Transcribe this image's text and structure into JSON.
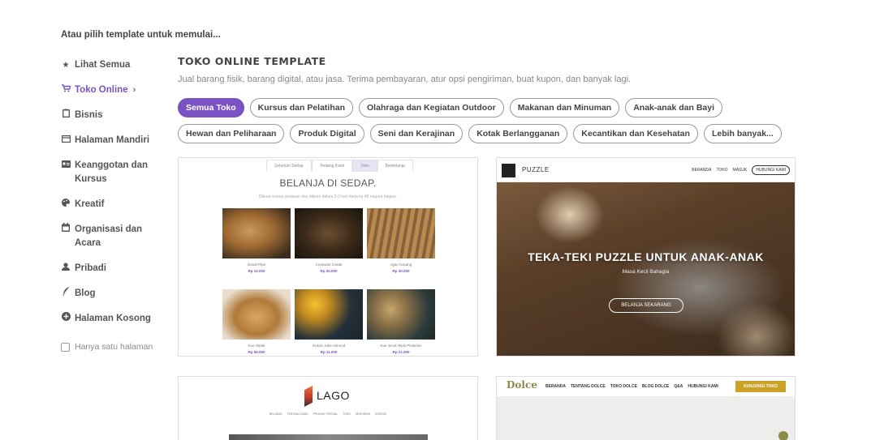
{
  "heading": "Atau pilih template untuk memulai...",
  "sidebar": {
    "items": [
      {
        "label": "Lihat Semua",
        "icon": "star-icon",
        "glyph": "★"
      },
      {
        "label": "Toko Online",
        "icon": "cart-icon",
        "glyph": "🛒",
        "active": true
      },
      {
        "label": "Bisnis",
        "icon": "clipboard-icon",
        "glyph": "📋"
      },
      {
        "label": "Halaman Mandiri",
        "icon": "window-icon",
        "glyph": "▭"
      },
      {
        "label": "Keanggotan dan Kursus",
        "icon": "id-card-icon",
        "glyph": "▤"
      },
      {
        "label": "Kreatif",
        "icon": "palette-icon",
        "glyph": "◕"
      },
      {
        "label": "Organisasi dan Acara",
        "icon": "calendar-icon",
        "glyph": "▦"
      },
      {
        "label": "Pribadi",
        "icon": "user-icon",
        "glyph": "👤"
      },
      {
        "label": "Blog",
        "icon": "feather-icon",
        "glyph": "✒"
      },
      {
        "label": "Halaman Kosong",
        "icon": "plus-circle-icon",
        "glyph": "⊕"
      }
    ],
    "single_page_label": "Hanya satu halaman"
  },
  "main": {
    "title": "TOKO ONLINE TEMPLATE",
    "description": "Jual barang fisik, barang digital, atau jasa. Terima pembayaran, atur opsi pengiriman, buat kupon, dan banyak lagi.",
    "chips_row1": [
      "Semua Toko",
      "Kursus dan Pelatihan",
      "Olahraga dan Kegiatan Outdoor",
      "Makanan dan Minuman",
      "Anak-anak dan Bayi"
    ],
    "chips_row2": [
      "Hewan dan Peliharaan",
      "Produk Digital",
      "Seni dan Kerajinan",
      "Kotak Berlangganan",
      "Kecantikan dan Kesehatan",
      "Lebih banyak..."
    ]
  },
  "templates": {
    "bakery": {
      "nav": [
        "Sebelum Sedap",
        "Tentang Kami",
        "Toko",
        "Berbelanja"
      ],
      "title": "BELANJA DI SEDAP.",
      "subtitle": "Dibuat sesuai pesanan dan dikirim dalam 2-3 hari kerja ke 48 negara bagian.",
      "products": [
        {
          "name": "Donat Pipe",
          "price": "Rp 12.000"
        },
        {
          "name": "Croissant Coklat",
          "price": "Rp 20.000"
        },
        {
          "name": "Ujian Kacang",
          "price": "Rp 30.000"
        },
        {
          "name": "Kue Steak",
          "price": "Rp 56.000"
        },
        {
          "name": "Dukuh Jahe Almond",
          "price": "Rp 11.000"
        },
        {
          "name": "Kue Jeruk Nipis Pistachio",
          "price": "Rp 21.000"
        }
      ]
    },
    "puzzle": {
      "brand": "PUZZLE",
      "menu": [
        "BERANDA",
        "TOKO",
        "MASUK"
      ],
      "contact_button": "HUBUNGI KAMI",
      "hero_title": "TEKA-TEKI PUZZLE UNTUK ANAK-ANAK",
      "hero_subtitle": "Masa Kecil Bahagia",
      "hero_button": "BELANJA SEKARANG"
    },
    "lago": {
      "brand": "LAGO",
      "nav": [
        "BELANJA",
        "TENTANG KAMI",
        "PRODUK SPESIAL",
        "TOKO",
        "DEKORASI",
        "KONTAK"
      ]
    },
    "dolce": {
      "brand": "Dolce",
      "menu": [
        "BERANDA",
        "TENTANG DOLCE",
        "TOKO DOLCE",
        "BLOG DOLCE",
        "Q&A",
        "HUBUNGI KAMI"
      ],
      "cta": "KUNJUNGI TOKO"
    }
  },
  "colors": {
    "accent": "#7a52c4",
    "dolce_gold": "#c9a227"
  }
}
